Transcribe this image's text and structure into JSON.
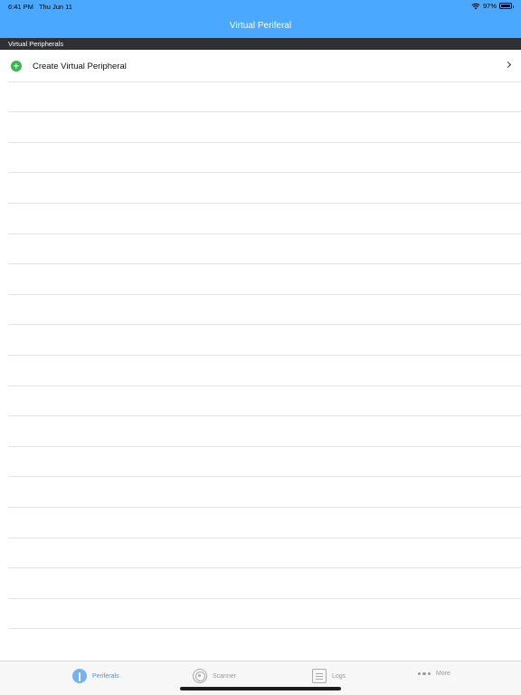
{
  "status_bar": {
    "time": "6:41 PM",
    "date": "Thu Jun 11",
    "battery_percent": "97%",
    "battery_level": 0.97,
    "icons": [
      "wifi-icon",
      "battery-icon"
    ]
  },
  "nav": {
    "title": "Virtual Periferal",
    "background_color": "#4aa8ff"
  },
  "section": {
    "header": "Virtual Peripherals"
  },
  "rows": [
    {
      "label": "Create Virtual Peripheral",
      "icon": "plus-circle-icon",
      "accessory": "chevron-right-icon"
    }
  ],
  "tabs": [
    {
      "label": "Periferals",
      "icon": "periferals-icon",
      "active": true
    },
    {
      "label": "Scanner",
      "icon": "scanner-icon",
      "active": false
    },
    {
      "label": "Logs",
      "icon": "logs-icon",
      "active": false
    },
    {
      "label": "More",
      "icon": "more-icon",
      "active": false
    }
  ],
  "colors": {
    "accent": "#3c97f5",
    "add_green": "#34b84a",
    "section_header_bg": "#2f3034"
  }
}
